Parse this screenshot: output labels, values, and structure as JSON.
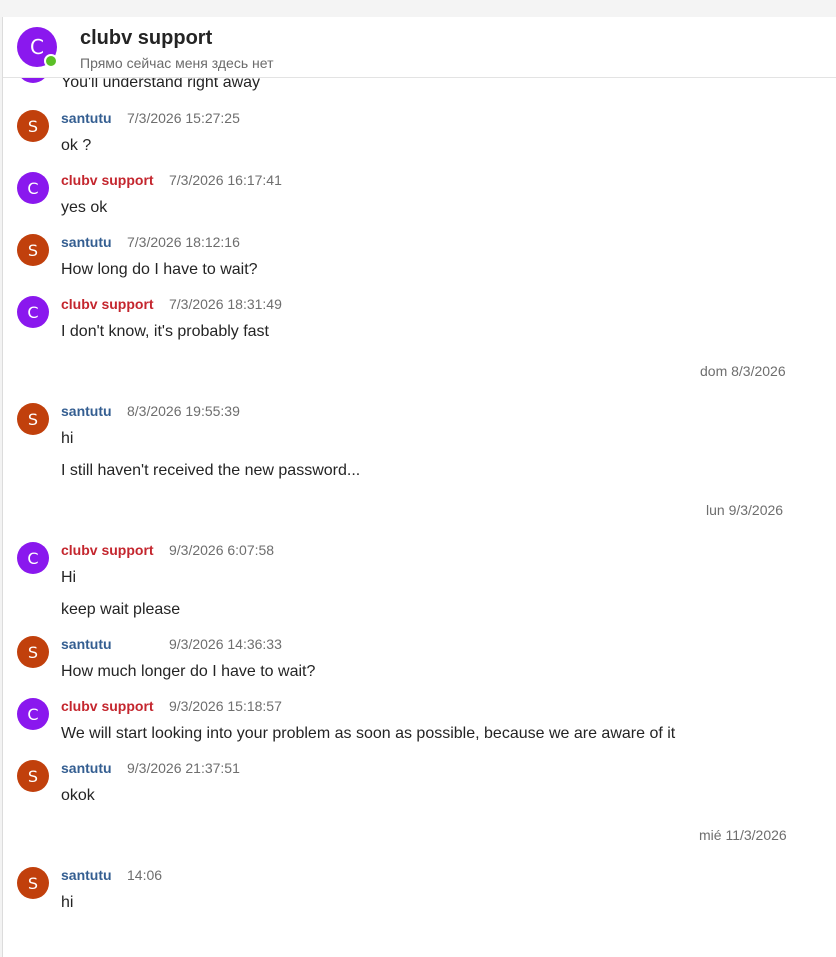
{
  "header": {
    "avatar_letter": "C",
    "title": "clubv support",
    "status": "Прямо сейчас меня здесь нет"
  },
  "colors": {
    "support": "#c4262e",
    "user": "#345e91",
    "support_avatar": "#8a18ee",
    "user_avatar": "#c1400c",
    "presence": "#5bbf27"
  },
  "messages": {
    "m0": {
      "text": "You'll understand right away"
    },
    "m1": {
      "avatar": "S",
      "author": "santutu",
      "time": "7/3/2026 15:27:25",
      "text": "ok ?"
    },
    "m2": {
      "avatar": "C",
      "author": "clubv support",
      "time": "7/3/2026 16:17:41",
      "text": "yes ok"
    },
    "m3": {
      "avatar": "S",
      "author": "santutu",
      "time": "7/3/2026 18:12:16",
      "text": "How long do I have to wait?"
    },
    "m4": {
      "avatar": "C",
      "author": "clubv support",
      "time": "7/3/2026 18:31:49",
      "text": "I don't know, it's probably fast"
    },
    "m5": {
      "avatar": "S",
      "author": "santutu",
      "time": "8/3/2026 19:55:39",
      "text": "hi",
      "text2": "I still haven't received the new password..."
    },
    "m6": {
      "avatar": "C",
      "author": "clubv support",
      "time": "9/3/2026 6:07:58",
      "text": "Hi",
      "text2": "keep wait please"
    },
    "m7": {
      "avatar": "S",
      "author": "santutu",
      "time": "9/3/2026 14:36:33",
      "text": "How much longer do I have to wait?"
    },
    "m8": {
      "avatar": "C",
      "author": "clubv support",
      "time": "9/3/2026 15:18:57",
      "text": "We will start looking into your problem as soon as possible, because we are aware of it"
    },
    "m9": {
      "avatar": "S",
      "author": "santutu",
      "time": "9/3/2026 21:37:51",
      "text": "okok"
    },
    "m10": {
      "avatar": "S",
      "author": "santutu",
      "time": "14:06",
      "text": "hi"
    }
  },
  "dividers": {
    "d1": "dom 8/3/2026",
    "d2": "lun 9/3/2026",
    "d3": "mié 11/3/2026"
  }
}
